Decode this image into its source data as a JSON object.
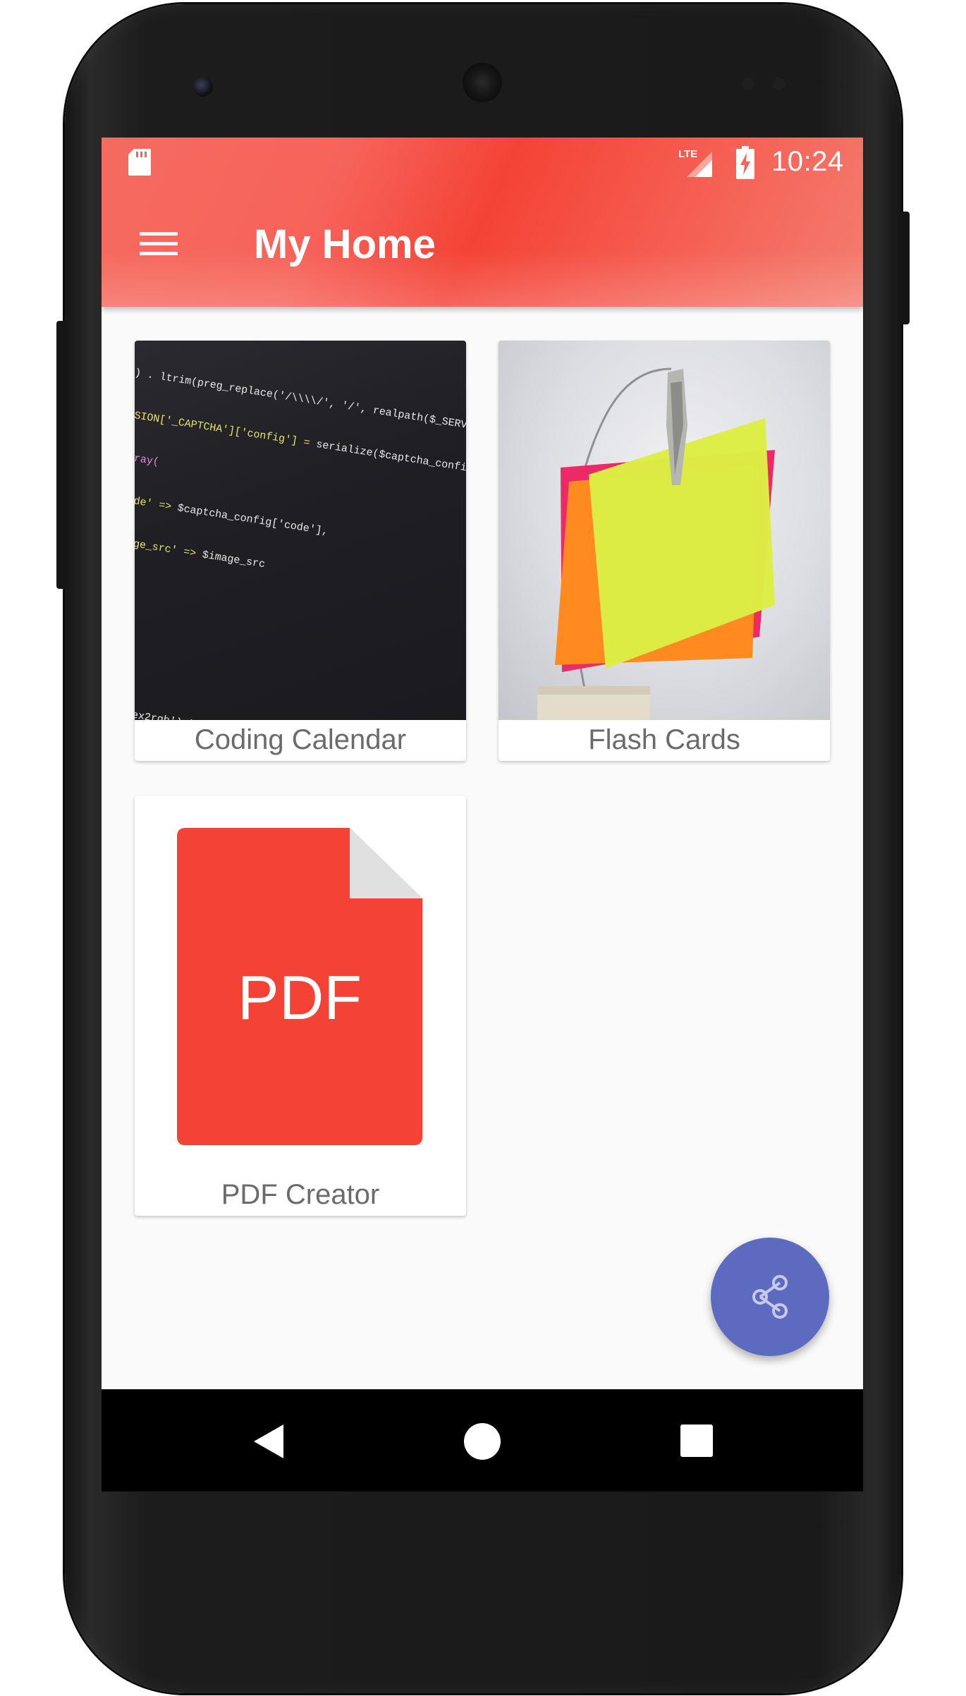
{
  "status_bar": {
    "time": "10:24",
    "network_label": "LTE",
    "icons": [
      "sd-card-icon",
      "lte-signal-icon",
      "battery-charging-icon"
    ]
  },
  "app_bar": {
    "title": "My Home",
    "menu_icon": "menu-icon",
    "colors": {
      "primary": "#f44336"
    }
  },
  "cards": [
    {
      "label": "Coding Calendar",
      "image": "code-screenshot"
    },
    {
      "label": "Flash Cards",
      "image": "sticky-notes-photo"
    },
    {
      "label": "PDF Creator",
      "image": "pdf-file-icon",
      "icon_text": "PDF",
      "icon_color": "#f44336"
    }
  ],
  "fab": {
    "icon": "share-icon",
    "color": "#5c6bc0"
  },
  "nav_bar": {
    "buttons": [
      "back-icon",
      "home-icon",
      "recents-icon"
    ]
  }
}
